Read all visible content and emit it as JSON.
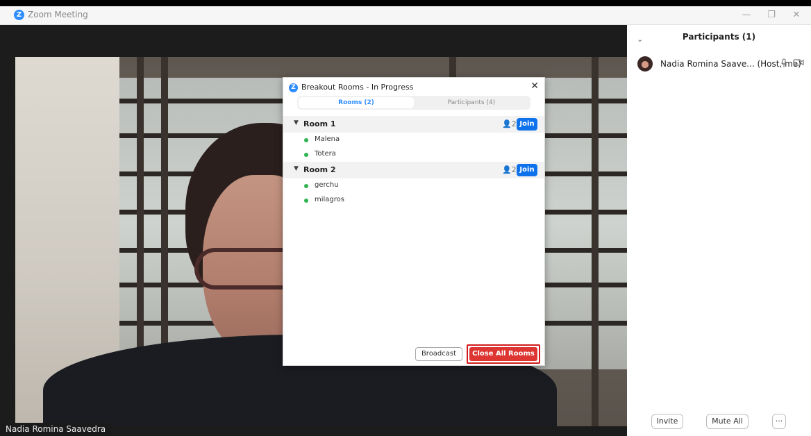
{
  "window": {
    "app_title": "Zoom Meeting",
    "controls": [
      "—",
      "❐",
      "✕"
    ]
  },
  "video": {
    "speaker_name": "Nadia Romina Saavedra"
  },
  "participants_panel": {
    "title": "Participants (1)",
    "participants": [
      {
        "name": "Nadia Romina Saave...",
        "role": "(Host, me)",
        "mic_icon": "mic-icon",
        "camera_icon": "camera-icon"
      }
    ],
    "buttons": {
      "invite": "Invite",
      "mute_all": "Mute All",
      "more": "···"
    }
  },
  "breakout_dialog": {
    "title": "Breakout Rooms - In Progress",
    "close": "✕",
    "tabs": [
      "Rooms (2)",
      "Participants (4)"
    ],
    "rooms": [
      {
        "name": "Room 1",
        "count": "2",
        "join_label": "Join",
        "members": [
          "Malena",
          "Totera"
        ]
      },
      {
        "name": "Room 2",
        "count": "2",
        "join_label": "Join",
        "members": [
          "gerchu",
          "milagros"
        ]
      }
    ],
    "broadcast_label": "Broadcast",
    "close_all_label": "Close All Rooms"
  },
  "colors": {
    "accent": "#2d8cff",
    "join_button": "#0e72ed",
    "close_all": "#dc3532",
    "online_dot": "#2fb351"
  }
}
